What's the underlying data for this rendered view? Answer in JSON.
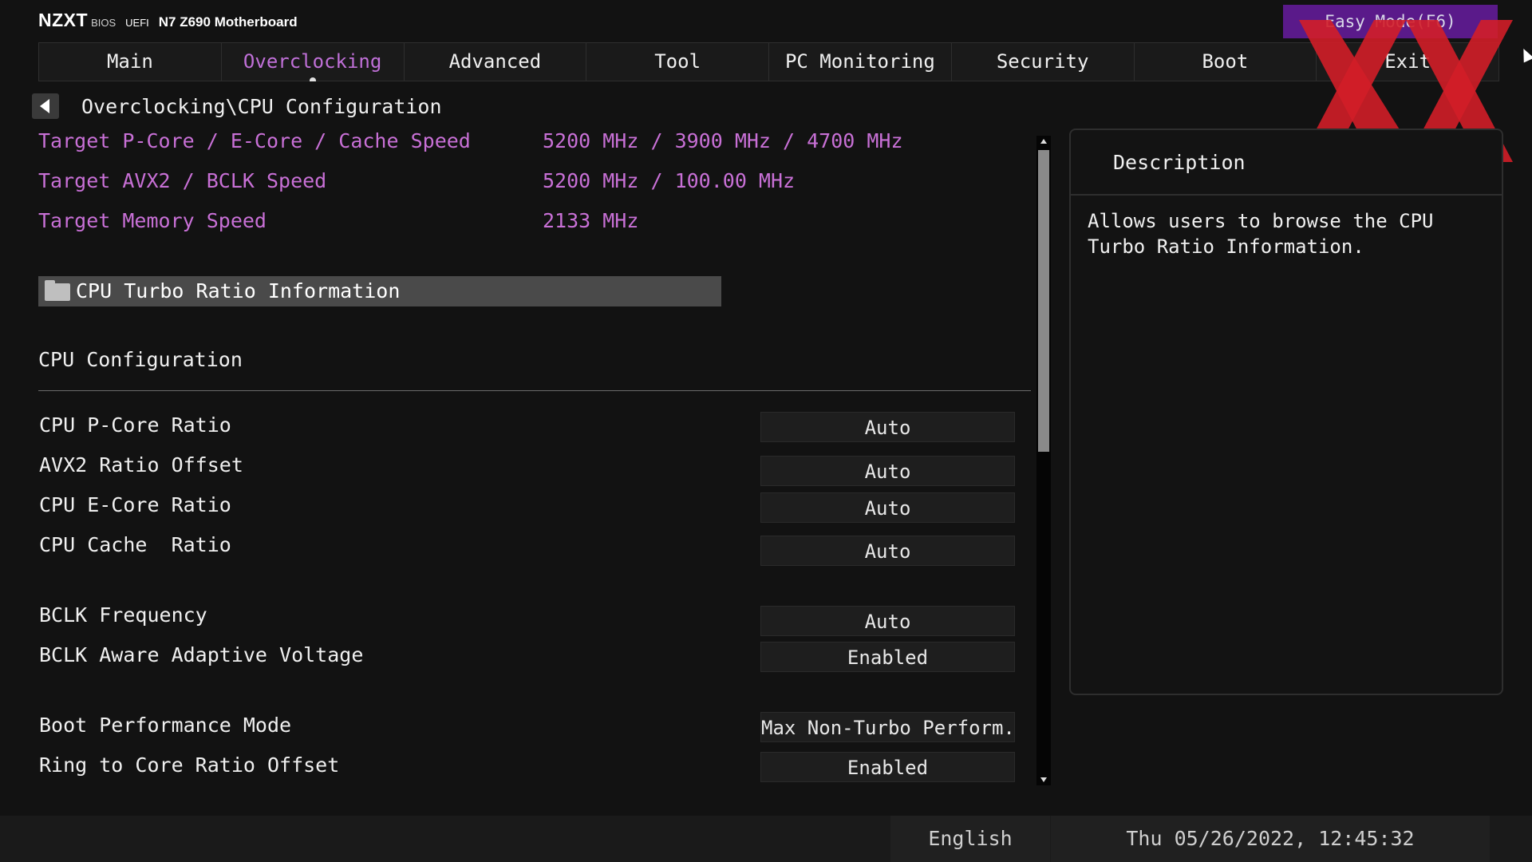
{
  "brand": {
    "logo": "NZXT",
    "bios": "BIOS",
    "uefi": "UEFI",
    "model": "N7 Z690 Motherboard"
  },
  "easy_mode_label": "Easy Mode(F6)",
  "tabs": [
    {
      "label": "Main"
    },
    {
      "label": "Overclocking"
    },
    {
      "label": "Advanced"
    },
    {
      "label": "Tool"
    },
    {
      "label": "PC Monitoring"
    },
    {
      "label": "Security"
    },
    {
      "label": "Boot"
    },
    {
      "label": "Exit"
    }
  ],
  "active_tab": "Overclocking",
  "breadcrumb": "Overclocking\\CPU Configuration",
  "info": [
    {
      "label": "Target P-Core / E-Core / Cache Speed",
      "value": "5200 MHz / 3900 MHz / 4700 MHz"
    },
    {
      "label": "Target AVX2 / BCLK Speed",
      "value": "5200 MHz / 100.00 MHz"
    },
    {
      "label": "Target Memory Speed",
      "value": "2133 MHz"
    }
  ],
  "submenu": "CPU Turbo Ratio Information",
  "section_title": "CPU Configuration",
  "settings": [
    {
      "label": "CPU P-Core Ratio",
      "value": "Auto"
    },
    {
      "label": "AVX2 Ratio Offset",
      "value": "Auto"
    },
    {
      "label": "CPU E-Core Ratio",
      "value": "Auto"
    },
    {
      "label": "CPU Cache  Ratio",
      "value": "Auto"
    },
    {
      "label": "BCLK Frequency",
      "value": "Auto"
    },
    {
      "label": "BCLK Aware Adaptive Voltage",
      "value": "Enabled"
    },
    {
      "label": "Boot Performance Mode",
      "value": "Max Non-Turbo Perform..."
    },
    {
      "label": "Ring to Core Ratio Offset",
      "value": "Enabled"
    }
  ],
  "description": {
    "title": "Description",
    "text": "Allows users to browse the CPU Turbo Ratio Information."
  },
  "footer": {
    "language": "English",
    "datetime": "Thu 05/26/2022, 12:45:32"
  },
  "colors": {
    "accent_purple": "#c870d6",
    "easy_mode_bg": "#5a1a8a",
    "watermark_red": "#d21e28"
  }
}
